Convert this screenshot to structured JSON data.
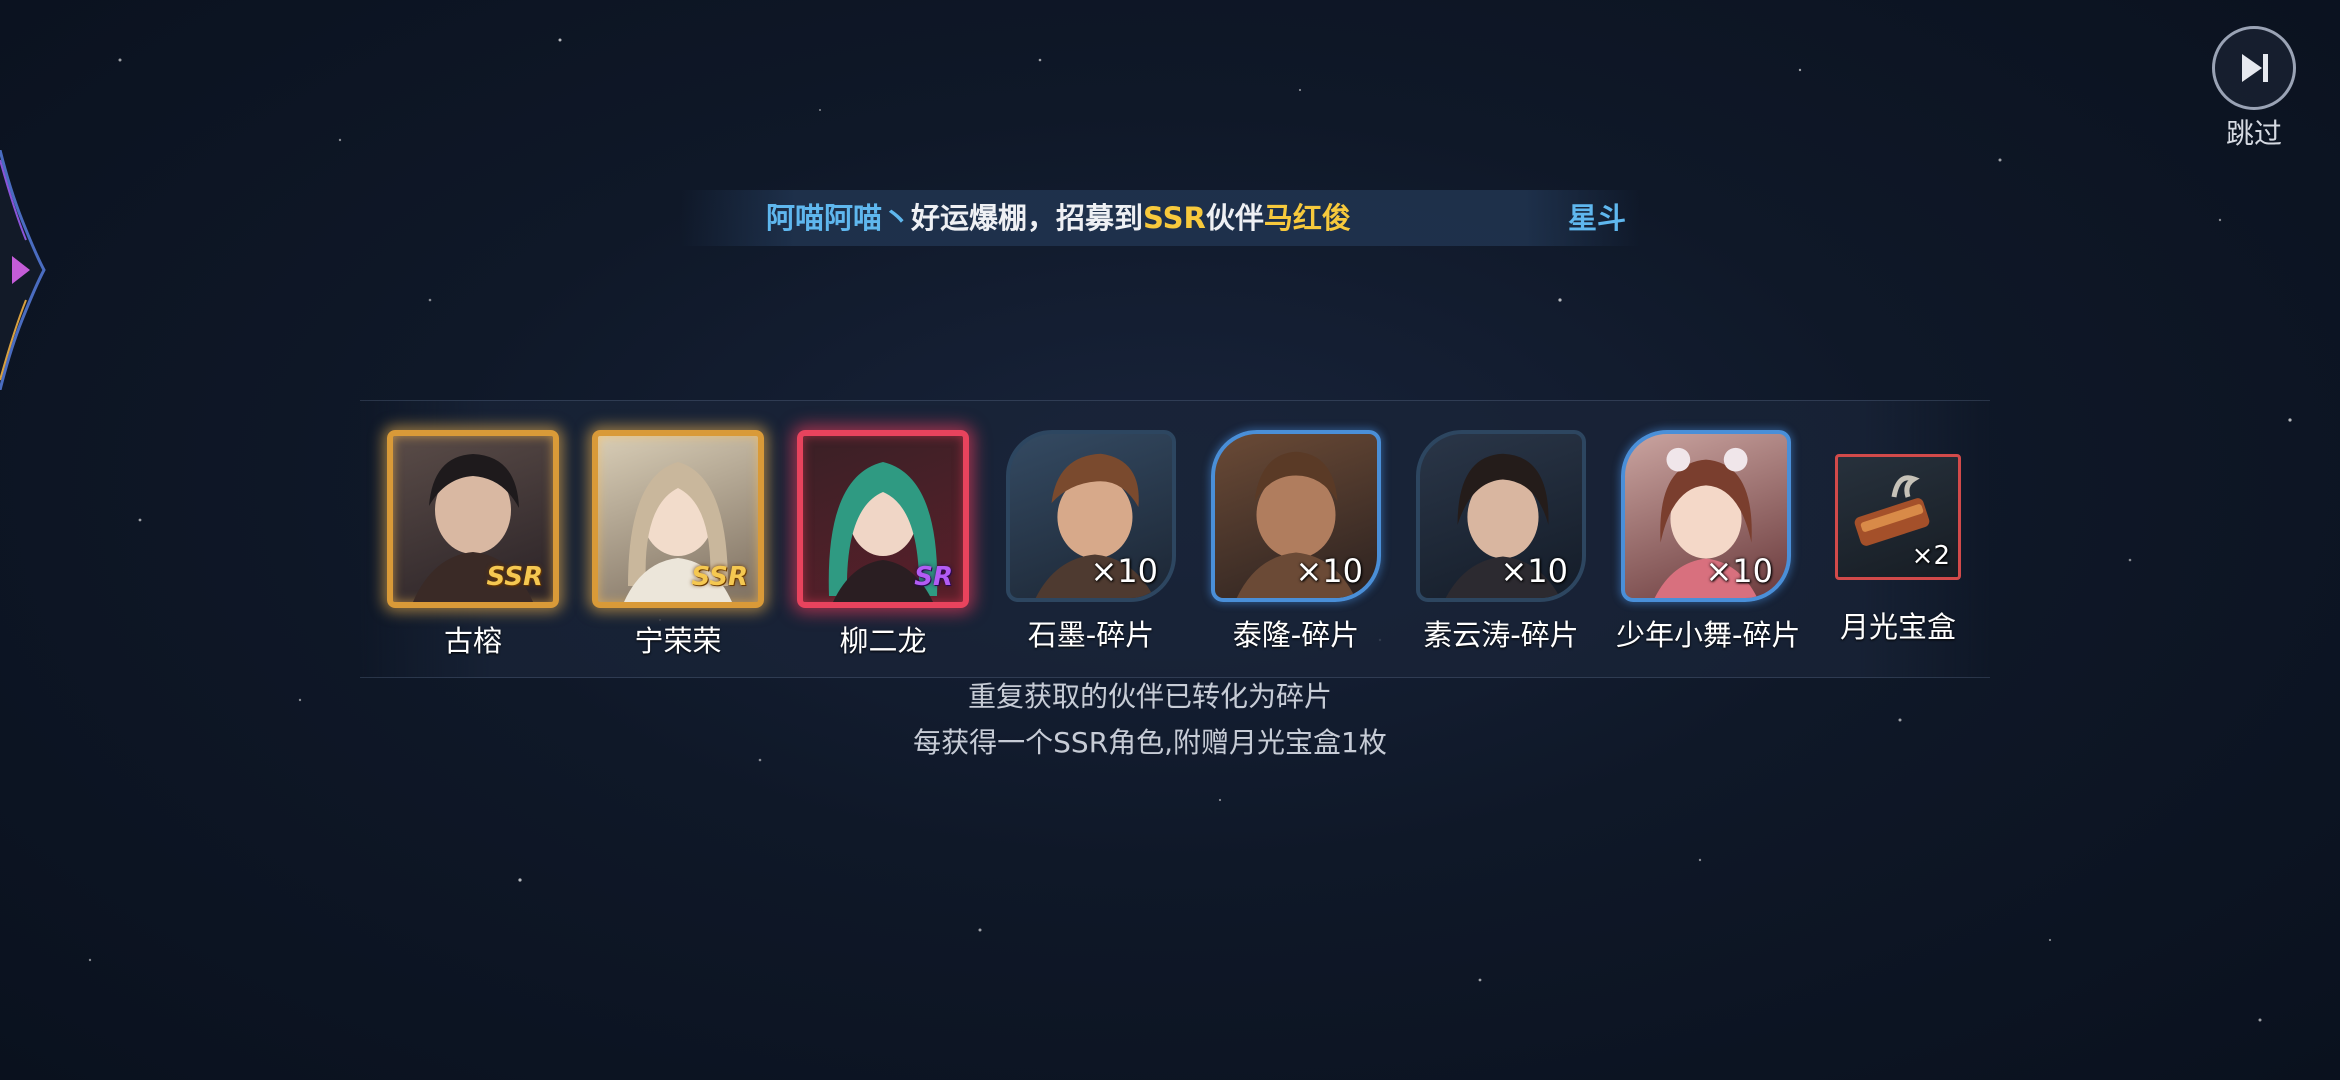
{
  "skip": {
    "label": "跳过",
    "icon": "skip-forward-icon"
  },
  "ticker": {
    "player": "阿喵阿喵丶",
    "text1": "好运爆棚，招募到",
    "rarity": "SSR",
    "text2": "伙伴",
    "character": "马红俊",
    "next": "星斗"
  },
  "rewards": [
    {
      "name": "古榕",
      "rarity": "SSR",
      "qty": ""
    },
    {
      "name": "宁荣荣",
      "rarity": "SSR",
      "qty": ""
    },
    {
      "name": "柳二龙",
      "rarity": "SR",
      "qty": ""
    },
    {
      "name": "石墨-碎片",
      "rarity": "",
      "qty": "×10"
    },
    {
      "name": "泰隆-碎片",
      "rarity": "",
      "qty": "×10"
    },
    {
      "name": "素云涛-碎片",
      "rarity": "",
      "qty": "×10"
    },
    {
      "name": "少年小舞-碎片",
      "rarity": "",
      "qty": "×10"
    },
    {
      "name": "月光宝盒",
      "rarity": "",
      "qty": "×2"
    }
  ],
  "notice": {
    "line1": "重复获取的伙伴已转化为碎片",
    "line2": "每获得一个SSR角色,附赠月光宝盒1枚"
  },
  "colors": {
    "player_blue": "#5fb7ee",
    "highlight_gold": "#f7c93c",
    "ssr_frame": "#d99a38",
    "sr_frame": "#e8435d",
    "fragment_frame": "#4a8fd8"
  }
}
